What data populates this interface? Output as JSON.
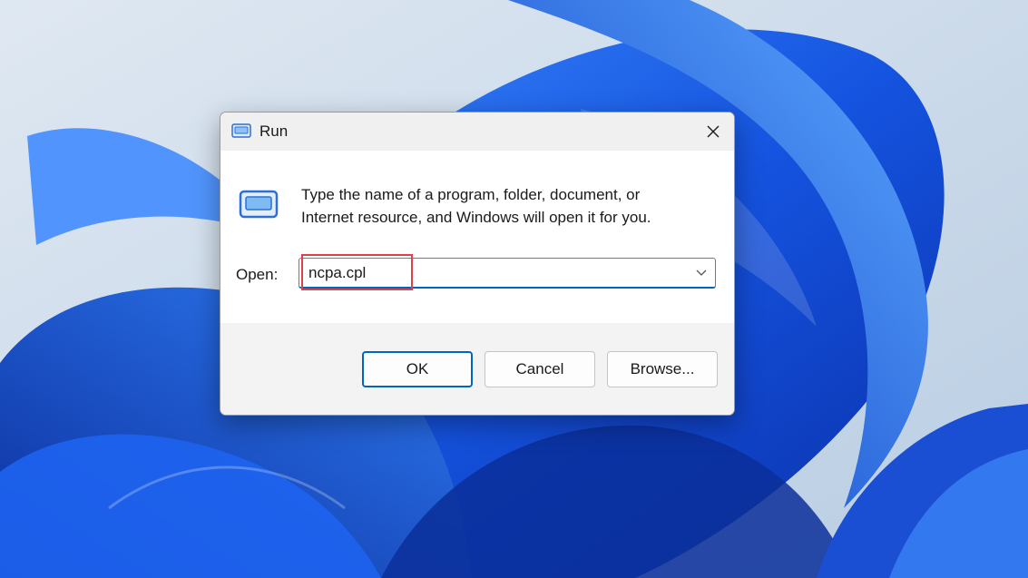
{
  "window": {
    "title": "Run",
    "title_icon": "run-icon",
    "close_icon": "close-icon"
  },
  "dialog": {
    "description_line1": "Type the name of a program, folder, document, or",
    "description_line2": "Internet resource, and Windows will open it for you.",
    "open_label": "Open:",
    "open_value": "ncpa.cpl",
    "dropdown_icon": "chevron-down-icon"
  },
  "buttons": {
    "ok": "OK",
    "cancel": "Cancel",
    "browse": "Browse..."
  },
  "colors": {
    "accent": "#0067c0",
    "highlight": "#e0404a",
    "wallpaper_bg": "#c9d6e6",
    "wallpaper_blue": "#1a5ae8"
  }
}
